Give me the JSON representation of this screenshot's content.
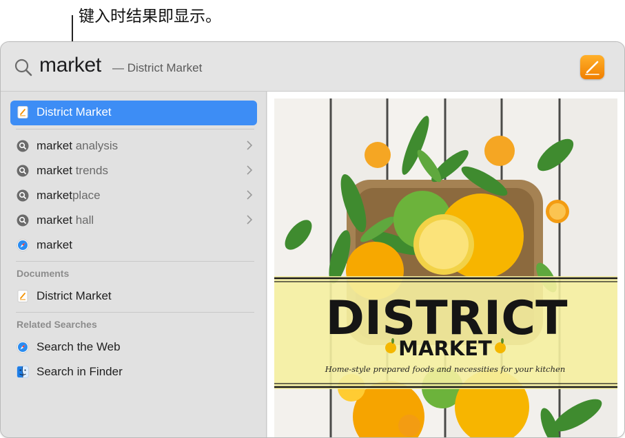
{
  "callout": {
    "text": "键入时结果即显示。"
  },
  "search": {
    "query": "market",
    "completion": "— District Market"
  },
  "results": {
    "top_hit": {
      "label": "District Market",
      "icon": "pages-document-icon"
    },
    "suggestions": [
      {
        "typed": "market",
        "rest": " analysis",
        "icon": "magnifier-icon"
      },
      {
        "typed": "market",
        "rest": " trends",
        "icon": "magnifier-icon"
      },
      {
        "typed": "market",
        "rest": "place",
        "icon": "magnifier-icon"
      },
      {
        "typed": "market",
        "rest": " hall",
        "icon": "magnifier-icon"
      }
    ],
    "web_result": {
      "label": "market",
      "icon": "safari-icon"
    },
    "documents": {
      "title": "Documents",
      "item": "District Market"
    },
    "related": {
      "title": "Related Searches",
      "items": [
        {
          "label": "Search the Web",
          "icon": "safari-icon"
        },
        {
          "label": "Search in Finder",
          "icon": "finder-icon"
        }
      ]
    }
  },
  "preview": {
    "title": "DISTRICT",
    "subtitle": "MARKET",
    "tagline": "Home-style prepared foods and necessities for your kitchen"
  },
  "colors": {
    "selection": "#3d8df5",
    "pages_icon": "#f49200",
    "banner": "#f5f0a0"
  }
}
